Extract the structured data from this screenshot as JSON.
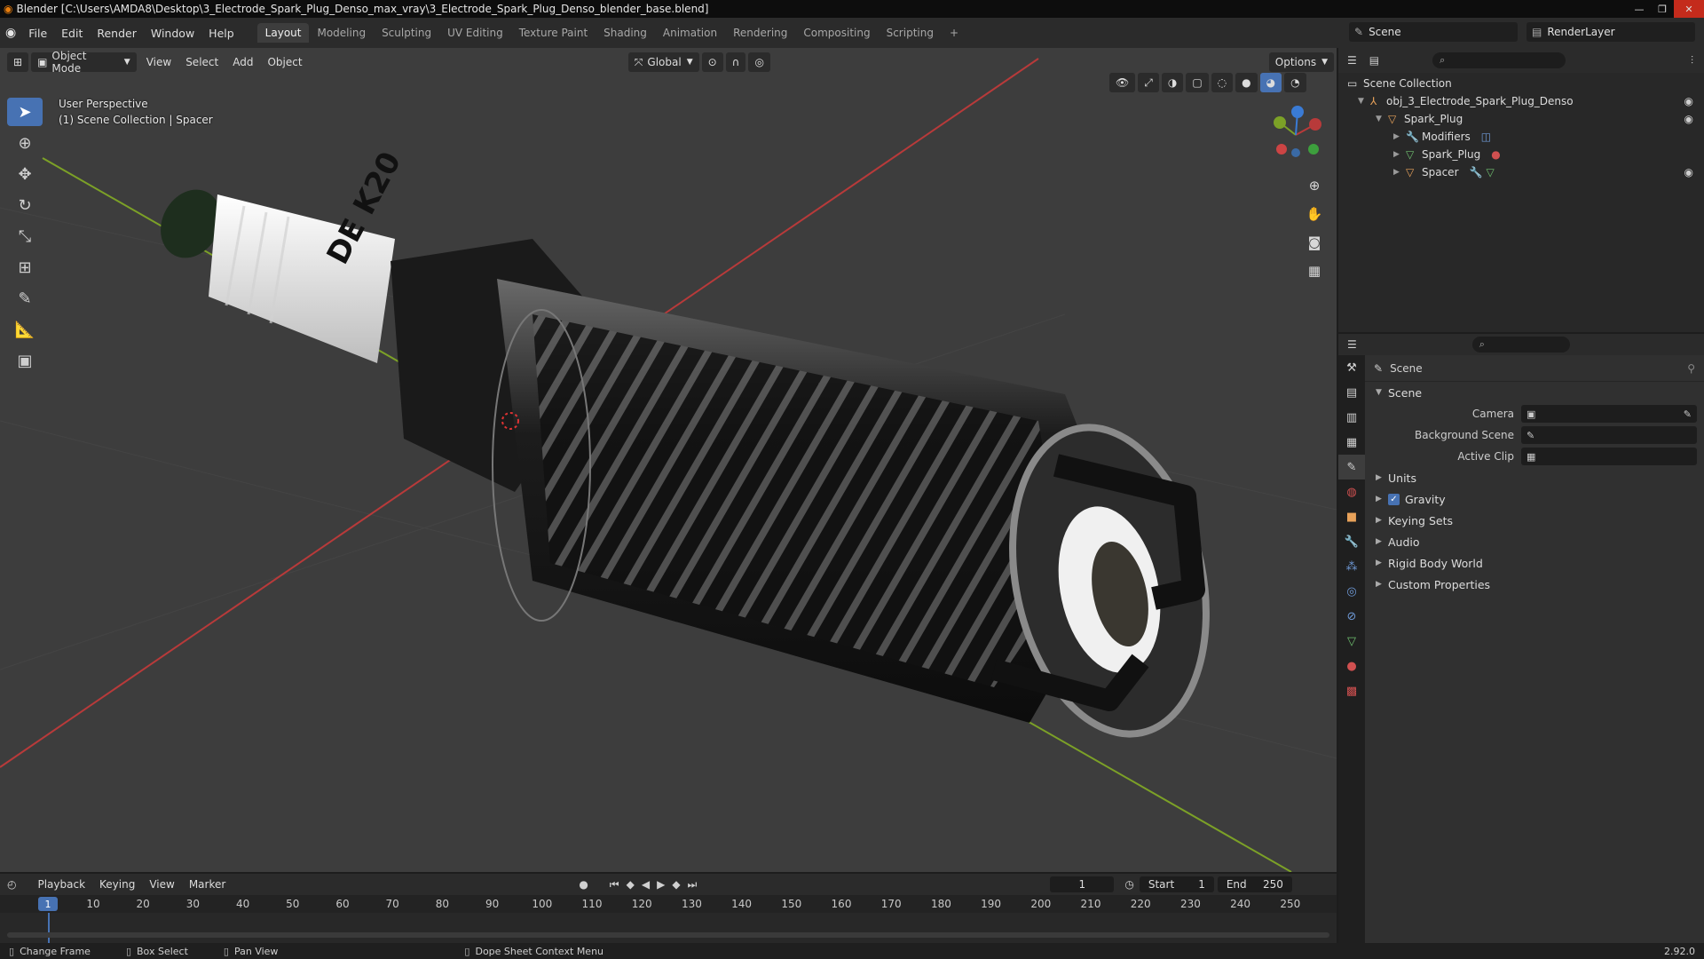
{
  "window": {
    "title": "Blender [C:\\Users\\AMDA8\\Desktop\\3_Electrode_Spark_Plug_Denso_max_vray\\3_Electrode_Spark_Plug_Denso_blender_base.blend]"
  },
  "menus": [
    "File",
    "Edit",
    "Render",
    "Window",
    "Help"
  ],
  "workspaces": [
    "Layout",
    "Modeling",
    "Sculpting",
    "UV Editing",
    "Texture Paint",
    "Shading",
    "Animation",
    "Rendering",
    "Compositing",
    "Scripting"
  ],
  "active_workspace": "Layout",
  "scene_name": "Scene",
  "render_layer": "RenderLayer",
  "viewport": {
    "mode": "Object Mode",
    "menus": [
      "View",
      "Select",
      "Add",
      "Object"
    ],
    "transform_orientation": "Global",
    "options_label": "Options",
    "info_line1": "User Perspective",
    "info_line2": "(1) Scene Collection | Spacer",
    "decal_text": "DE K20"
  },
  "outliner": {
    "root": "Scene Collection",
    "items": [
      {
        "label": "obj_3_Electrode_Spark_Plug_Denso",
        "depth": 1
      },
      {
        "label": "Spark_Plug",
        "depth": 2
      },
      {
        "label": "Modifiers",
        "depth": 3
      },
      {
        "label": "Spark_Plug",
        "depth": 3
      },
      {
        "label": "Spacer",
        "depth": 3
      }
    ]
  },
  "properties": {
    "header": "Scene",
    "panel": "Scene",
    "fields": [
      {
        "label": "Camera",
        "value": ""
      },
      {
        "label": "Background Scene",
        "value": ""
      },
      {
        "label": "Active Clip",
        "value": ""
      }
    ],
    "sections": [
      "Units",
      "Gravity",
      "Keying Sets",
      "Audio",
      "Rigid Body World",
      "Custom Properties"
    ],
    "gravity_checked": true
  },
  "timeline": {
    "menus": [
      "Playback",
      "Keying",
      "View",
      "Marker"
    ],
    "current_frame": "1",
    "start_label": "Start",
    "start": "1",
    "end_label": "End",
    "end": "250",
    "ticks": [
      "10",
      "20",
      "30",
      "40",
      "50",
      "60",
      "70",
      "80",
      "90",
      "100",
      "110",
      "120",
      "130",
      "140",
      "150",
      "160",
      "170",
      "180",
      "190",
      "200",
      "210",
      "220",
      "230",
      "240",
      "250"
    ],
    "cursor_label": "1"
  },
  "status": {
    "items": [
      "Change Frame",
      "Box Select",
      "Pan View",
      "Dope Sheet Context Menu"
    ],
    "version": "2.92.0"
  },
  "colors": {
    "accent": "#4772b3",
    "x_axis": "#b83a3a",
    "y_axis": "#7ca127",
    "orange": "#e87d0d"
  }
}
